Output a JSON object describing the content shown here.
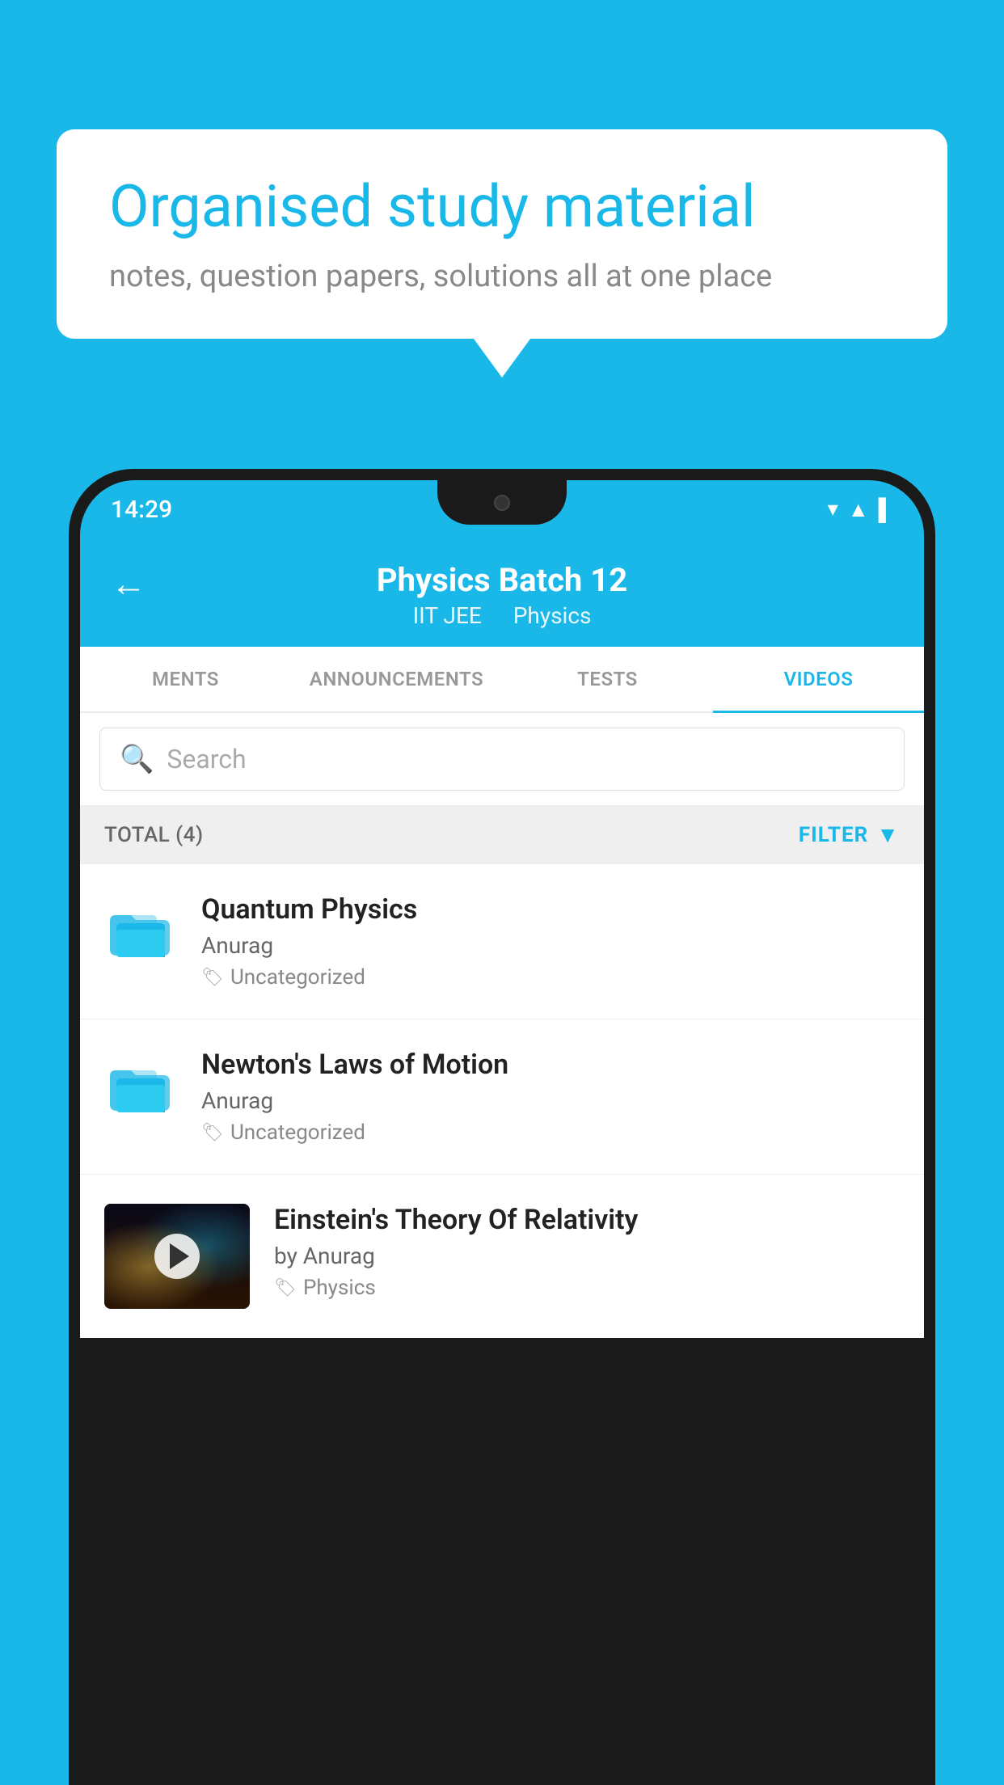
{
  "background_color": "#1ab8e8",
  "speech_bubble": {
    "headline": "Organised study material",
    "subtext": "notes, question papers, solutions all at one place"
  },
  "phone": {
    "status_bar": {
      "time": "14:29",
      "icons": [
        "wifi",
        "signal",
        "battery"
      ]
    },
    "header": {
      "back_label": "←",
      "title": "Physics Batch 12",
      "subtitle_1": "IIT JEE",
      "subtitle_2": "Physics"
    },
    "tabs": [
      {
        "label": "MENTS",
        "active": false
      },
      {
        "label": "ANNOUNCEMENTS",
        "active": false
      },
      {
        "label": "TESTS",
        "active": false
      },
      {
        "label": "VIDEOS",
        "active": true
      }
    ],
    "search": {
      "placeholder": "Search"
    },
    "filter_bar": {
      "total_label": "TOTAL (4)",
      "filter_label": "FILTER"
    },
    "video_items": [
      {
        "title": "Quantum Physics",
        "author": "Anurag",
        "tag": "Uncategorized",
        "has_thumbnail": false
      },
      {
        "title": "Newton's Laws of Motion",
        "author": "Anurag",
        "tag": "Uncategorized",
        "has_thumbnail": false
      },
      {
        "title": "Einstein's Theory Of Relativity",
        "author": "by Anurag",
        "tag": "Physics",
        "has_thumbnail": true
      }
    ]
  }
}
